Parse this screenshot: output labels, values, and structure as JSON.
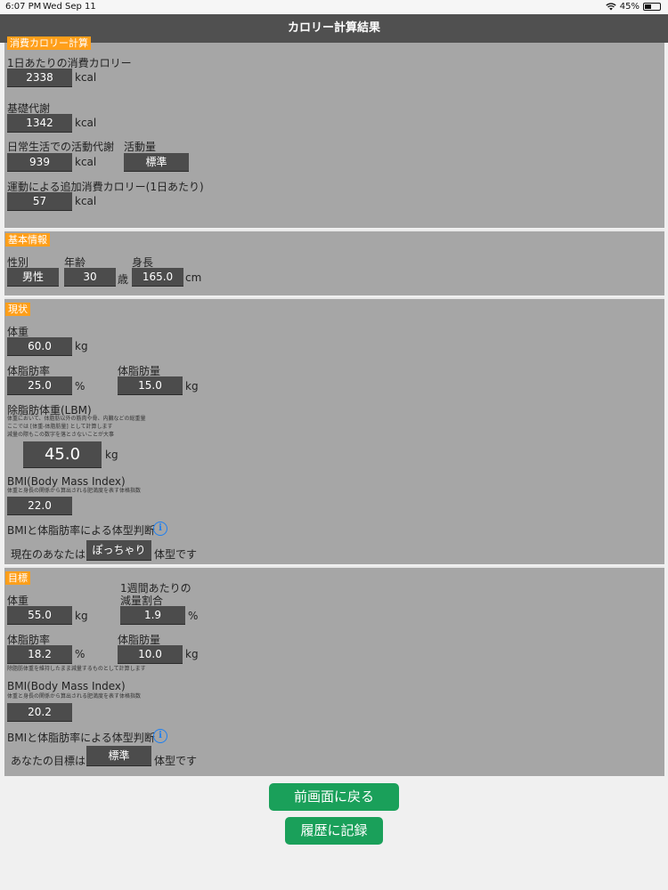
{
  "status_bar": {
    "time": "6:07 PM",
    "date": "Wed Sep 11",
    "battery": "45%",
    "battery_level": 0.45,
    "wifi_icon": "wifi-icon"
  },
  "header": {
    "title": "カロリー計算結果"
  },
  "consumption": {
    "tag": "消費カロリー計算",
    "daily_label": "1日あたりの消費カロリー",
    "daily_value": "2338",
    "daily_unit": "kcal",
    "bmr_label": "基礎代謝",
    "bmr_value": "1342",
    "bmr_unit": "kcal",
    "activity_label": "日常生活での活動代謝",
    "activity_value": "939",
    "activity_unit": "kcal",
    "level_label": "活動量",
    "level_value": "標準",
    "exercise_label": "運動による追加消費カロリー(1日あたり)",
    "exercise_value": "57",
    "exercise_unit": "kcal"
  },
  "basic": {
    "tag": "基本情報",
    "sex_label": "性別",
    "sex_value": "男性",
    "age_label": "年齢",
    "age_value": "30",
    "age_unit": "歳",
    "height_label": "身長",
    "height_value": "165.0",
    "height_unit": "cm"
  },
  "current": {
    "tag": "現状",
    "weight_label": "体重",
    "weight_value": "60.0",
    "weight_unit": "kg",
    "fat_rate_label": "体脂肪率",
    "fat_rate_value": "25.0",
    "fat_rate_unit": "%",
    "fat_mass_label": "体脂肪量",
    "fat_mass_value": "15.0",
    "fat_mass_unit": "kg",
    "lbm_label": "除脂肪体重(LBM)",
    "lbm_note_1": "体重において、体脂肪以外の筋肉や骨、内臓などの総重量",
    "lbm_note_2": "ここでは [体重-体脂肪量] として計算します",
    "lbm_note_3": "減量の際もこの数字を落とさないことが大事",
    "lbm_value": "45.0",
    "lbm_unit": "kg",
    "bmi_label": "BMI(Body Mass Index)",
    "bmi_note": "体重と身長の関係から算出される肥満度を表す体格指数",
    "bmi_value": "22.0",
    "judge_label": "BMIと体脂肪率による体型判断",
    "judge_prefix": "現在のあなたは",
    "judge_value": "ぽっちゃり",
    "judge_suffix": "体型です"
  },
  "goal": {
    "tag": "目標",
    "weight_label": "体重",
    "weight_value": "55.0",
    "weight_unit": "kg",
    "rate_label_1": "1週間あたりの",
    "rate_label_2": "減量割合",
    "rate_value": "1.9",
    "rate_unit": "%",
    "fat_rate_label": "体脂肪率",
    "fat_rate_value": "18.2",
    "fat_rate_unit": "%",
    "fat_mass_label": "体脂肪量",
    "fat_mass_value": "10.0",
    "fat_mass_unit": "kg",
    "fat_note": "除脂肪体重を維持したまま減量するものとして計算します",
    "bmi_label": "BMI(Body Mass Index)",
    "bmi_note": "体重と身長の関係から算出される肥満度を表す体格指数",
    "bmi_value": "20.2",
    "judge_label": "BMIと体脂肪率による体型判断",
    "judge_prefix": "あなたの目標は",
    "judge_value": "標準",
    "judge_suffix": "体型です"
  },
  "buttons": {
    "back": "前画面に戻る",
    "record": "履歴に記録"
  },
  "icons": {
    "info": "i"
  },
  "colors": {
    "accent_tag": "#ff9f1a",
    "button_green": "#1aa05a",
    "info_blue": "#1d7ff0"
  }
}
